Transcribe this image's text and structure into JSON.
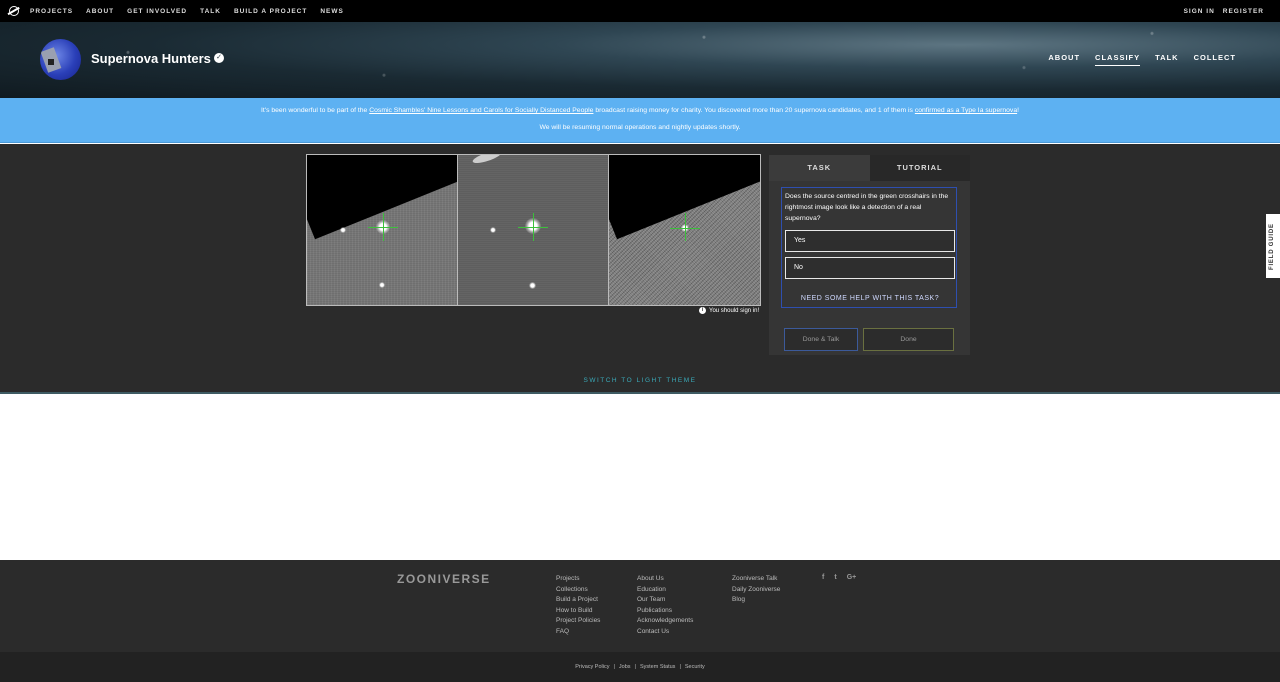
{
  "topnav": {
    "links": [
      "PROJECTS",
      "ABOUT",
      "GET INVOLVED",
      "TALK",
      "BUILD A PROJECT",
      "NEWS"
    ],
    "sign_in": "SIGN IN",
    "register": "REGISTER"
  },
  "project": {
    "title": "Supernova Hunters",
    "nav": [
      "ABOUT",
      "CLASSIFY",
      "TALK",
      "COLLECT"
    ],
    "active_nav": "CLASSIFY"
  },
  "announcement": {
    "line1_pre": "It's been wonderful to be part of the ",
    "line1_link1": "Cosmic Shambles' Nine Lessons and Carols for Socially Distanced People",
    "line1_mid": " broadcast raising money for charity. You discovered more than 20 supernova candidates, and 1 of them is ",
    "line1_link2": "confirmed as a Type Ia supernova",
    "line1_post": "!",
    "line2": "We will be resuming normal operations and nightly updates shortly."
  },
  "classifier": {
    "signin_note": "You should sign in!",
    "tabs": [
      "TASK",
      "TUTORIAL"
    ],
    "question": "Does the source centred in the green crosshairs in the rightmost image look like a detection of a real supernova?",
    "answers": [
      "Yes",
      "No"
    ],
    "help": "NEED SOME HELP WITH THIS TASK?",
    "done_talk": "Done & Talk",
    "done": "Done",
    "field_guide": "FIELD GUIDE",
    "switch_theme": "SWITCH TO LIGHT THEME"
  },
  "footer": {
    "logo": "ZOONIVERSE",
    "col1": [
      "Projects",
      "Collections",
      "Build a Project",
      "How to Build",
      "Project Policies",
      "FAQ"
    ],
    "col2": [
      "About Us",
      "Education",
      "Our Team",
      "Publications",
      "Acknowledgements",
      "Contact Us"
    ],
    "col3": [
      "Zooniverse Talk",
      "Daily Zooniverse",
      "Blog"
    ],
    "social": [
      "f",
      "t",
      "G+"
    ],
    "bottom": [
      "Privacy Policy",
      "Jobs",
      "System Status",
      "Security"
    ]
  },
  "colors": {
    "announcement_bg": "#5db1f2",
    "classifier_bg": "#2b2b2b",
    "crosshair": "#3bbf3b",
    "switch_theme": "#3aa9b8"
  }
}
